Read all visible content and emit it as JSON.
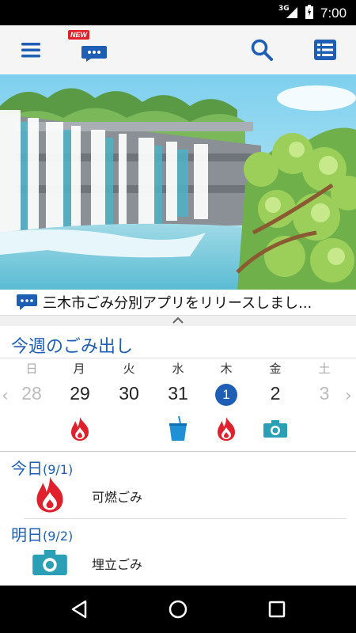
{
  "status_bar": {
    "network": "3G",
    "time": "7:00"
  },
  "app_bar": {
    "menu_icon": "hamburger-menu-icon",
    "news_badge": "NEW",
    "news_icon": "chat-bubble-icon",
    "search_icon": "search-icon",
    "list_icon": "list-icon"
  },
  "news": {
    "headline": "三木市ごみ分別アプリをリリースしまし..."
  },
  "week": {
    "title": "今週のごみ出し",
    "weekdays": [
      "日",
      "月",
      "火",
      "水",
      "木",
      "金",
      "土"
    ],
    "dates": [
      "28",
      "29",
      "30",
      "31",
      "1",
      "2",
      "3"
    ],
    "prev_arrow": "‹",
    "next_arrow": "›"
  },
  "today": {
    "label": "今日",
    "date": "(9/1)",
    "garbage": "可燃ごみ"
  },
  "tomorrow": {
    "label": "明日",
    "date": "(9/2)",
    "garbage": "埋立ごみ"
  },
  "colors": {
    "accent": "#1e5fb5",
    "fire": "#e0202a",
    "teal": "#2a9fb5",
    "water": "#1f8fd6"
  }
}
